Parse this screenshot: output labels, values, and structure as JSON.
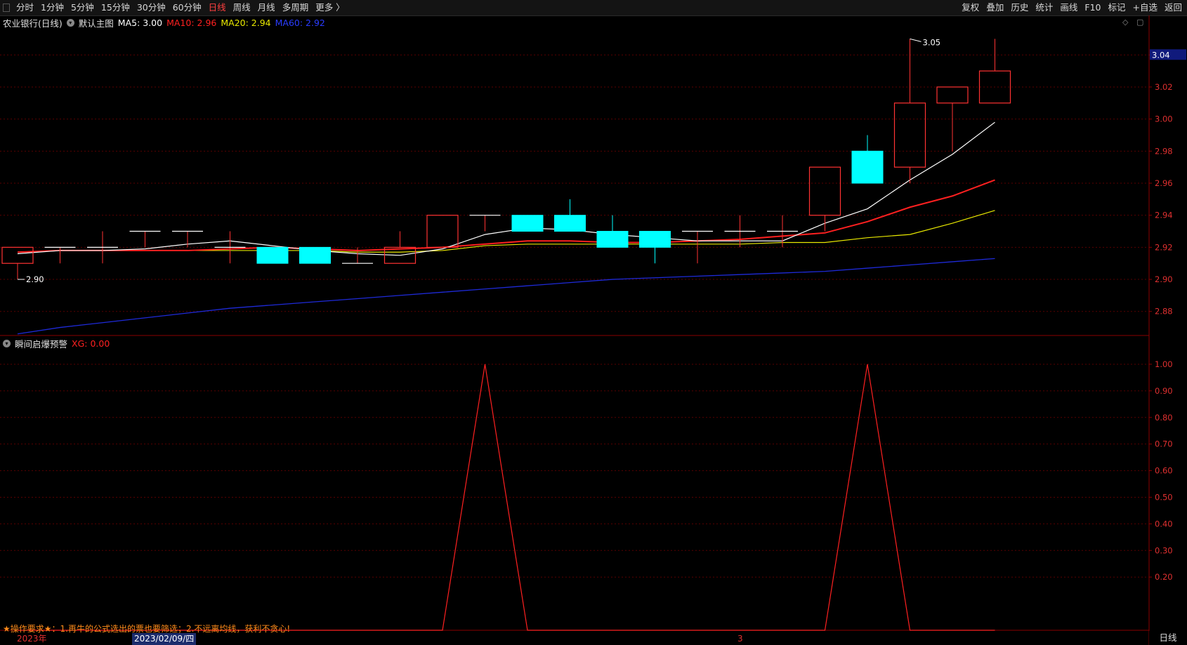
{
  "toolbar": {
    "periods": [
      "分时",
      "1分钟",
      "5分钟",
      "15分钟",
      "30分钟",
      "60分钟",
      "日线",
      "周线",
      "月线",
      "多周期",
      "更多 〉"
    ],
    "active_period": "日线",
    "right_buttons": [
      "复权",
      "叠加",
      "历史",
      "统计",
      "画线",
      "F10",
      "标记",
      "+自选",
      "返回"
    ]
  },
  "main_panel": {
    "stock_title": "农业银行(日线)",
    "template": "默认主图",
    "ma5": "MA5: 3.00",
    "ma10": "MA10: 2.96",
    "ma20": "MA20: 2.94",
    "ma60": "MA60: 2.92",
    "high_label": "3.05",
    "low_label": "2.90",
    "last_price": "3.04",
    "y_ticks": [
      "3.04",
      "3.02",
      "3.00",
      "2.98",
      "2.96",
      "2.94",
      "2.92",
      "2.90",
      "2.88"
    ]
  },
  "indicator_panel": {
    "name": "瞬间启爆预警",
    "value": "XG: 0.00",
    "y_ticks": [
      "1.00",
      "0.90",
      "0.80",
      "0.70",
      "0.60",
      "0.50",
      "0.40",
      "0.30",
      "0.20"
    ],
    "note": "★操作要求★：1.再牛的公式选出的票也要筛选；2.不远离均线，获利不贪心!"
  },
  "date_axis": {
    "year": "2023年",
    "cursor_date": "2023/02/09/四",
    "month": "3",
    "period_label": "日线"
  },
  "colors": {
    "up": "#ff3232",
    "down": "#00ffff",
    "ma5": "#ffffff",
    "ma10": "#ff2020",
    "ma20": "#e8e800",
    "ma60": "#1e2ad8",
    "signal": "#ff2020",
    "grid": "#5a0000"
  },
  "chart_data": {
    "type": "candlestick",
    "candles": [
      {
        "o": 2.91,
        "h": 2.92,
        "l": 2.9,
        "c": 2.92
      },
      {
        "o": 2.92,
        "h": 2.92,
        "l": 2.91,
        "c": 2.92
      },
      {
        "o": 2.92,
        "h": 2.93,
        "l": 2.91,
        "c": 2.92
      },
      {
        "o": 2.93,
        "h": 2.93,
        "l": 2.92,
        "c": 2.93
      },
      {
        "o": 2.93,
        "h": 2.93,
        "l": 2.92,
        "c": 2.93
      },
      {
        "o": 2.92,
        "h": 2.93,
        "l": 2.91,
        "c": 2.92
      },
      {
        "o": 2.92,
        "h": 2.92,
        "l": 2.91,
        "c": 2.91
      },
      {
        "o": 2.92,
        "h": 2.92,
        "l": 2.91,
        "c": 2.91
      },
      {
        "o": 2.91,
        "h": 2.92,
        "l": 2.91,
        "c": 2.91
      },
      {
        "o": 2.91,
        "h": 2.93,
        "l": 2.91,
        "c": 2.92
      },
      {
        "o": 2.92,
        "h": 2.94,
        "l": 2.92,
        "c": 2.94
      },
      {
        "o": 2.94,
        "h": 2.94,
        "l": 2.93,
        "c": 2.94
      },
      {
        "o": 2.94,
        "h": 2.94,
        "l": 2.93,
        "c": 2.93
      },
      {
        "o": 2.94,
        "h": 2.95,
        "l": 2.93,
        "c": 2.93
      },
      {
        "o": 2.93,
        "h": 2.94,
        "l": 2.92,
        "c": 2.92
      },
      {
        "o": 2.93,
        "h": 2.93,
        "l": 2.91,
        "c": 2.92
      },
      {
        "o": 2.93,
        "h": 2.93,
        "l": 2.91,
        "c": 2.93
      },
      {
        "o": 2.93,
        "h": 2.94,
        "l": 2.92,
        "c": 2.93
      },
      {
        "o": 2.93,
        "h": 2.94,
        "l": 2.92,
        "c": 2.93
      },
      {
        "o": 2.94,
        "h": 2.97,
        "l": 2.93,
        "c": 2.97
      },
      {
        "o": 2.98,
        "h": 2.99,
        "l": 2.96,
        "c": 2.96
      },
      {
        "o": 2.97,
        "h": 3.05,
        "l": 2.96,
        "c": 3.01
      },
      {
        "o": 3.01,
        "h": 3.02,
        "l": 2.98,
        "c": 3.02
      },
      {
        "o": 3.01,
        "h": 3.05,
        "l": 3.01,
        "c": 3.03
      }
    ],
    "ma5": [
      2.916,
      2.918,
      2.918,
      2.919,
      2.922,
      2.924,
      2.921,
      2.918,
      2.916,
      2.915,
      2.919,
      2.928,
      2.932,
      2.931,
      2.928,
      2.926,
      2.924,
      2.924,
      2.924,
      2.935,
      2.944,
      2.962,
      2.978,
      2.998
    ],
    "ma10": [
      2.917,
      2.918,
      2.918,
      2.918,
      2.918,
      2.919,
      2.92,
      2.919,
      2.918,
      2.919,
      2.92,
      2.922,
      2.924,
      2.924,
      2.923,
      2.923,
      2.924,
      2.925,
      2.927,
      2.929,
      2.936,
      2.945,
      2.952,
      2.962
    ],
    "ma20": [
      2.917,
      2.918,
      2.918,
      2.918,
      2.918,
      2.918,
      2.918,
      2.918,
      2.917,
      2.917,
      2.918,
      2.921,
      2.922,
      2.922,
      2.922,
      2.922,
      2.922,
      2.922,
      2.923,
      2.923,
      2.926,
      2.928,
      2.935,
      2.943
    ],
    "ma60": [
      2.866,
      2.87,
      2.873,
      2.876,
      2.879,
      2.882,
      2.884,
      2.886,
      2.888,
      2.89,
      2.892,
      2.894,
      2.896,
      2.898,
      2.9,
      2.901,
      2.902,
      2.903,
      2.904,
      2.905,
      2.907,
      2.909,
      2.911,
      2.913
    ],
    "signal": [
      0,
      0,
      0,
      0,
      0,
      0,
      0,
      0,
      0,
      0,
      0,
      1,
      0,
      0,
      0,
      0,
      0,
      0,
      0,
      0,
      1,
      0,
      0,
      0
    ],
    "ylim_price": [
      2.865,
      3.055
    ],
    "ylim_signal": [
      0.0,
      1.05
    ]
  }
}
